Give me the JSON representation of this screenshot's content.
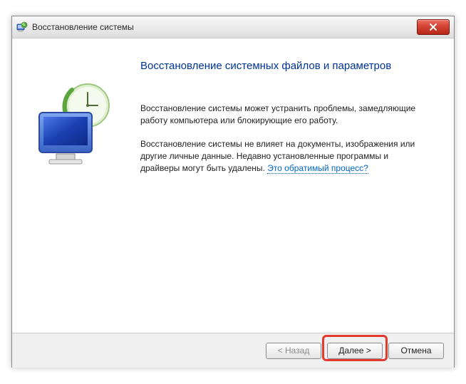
{
  "window": {
    "title": "Восстановление системы"
  },
  "heading": "Восстановление системных файлов и параметров",
  "para1": "Восстановление системы может устранить проблемы, замедляющие работу компьютера или блокирующие его работу.",
  "para2_prefix": "Восстановление системы не влияет на документы, изображения или другие личные данные. Недавно установленные программы и драйверы могут быть удалены. ",
  "para2_link": "Это обратимый процесс?",
  "buttons": {
    "back": "< Назад",
    "next": "Далее >",
    "cancel": "Отмена"
  }
}
